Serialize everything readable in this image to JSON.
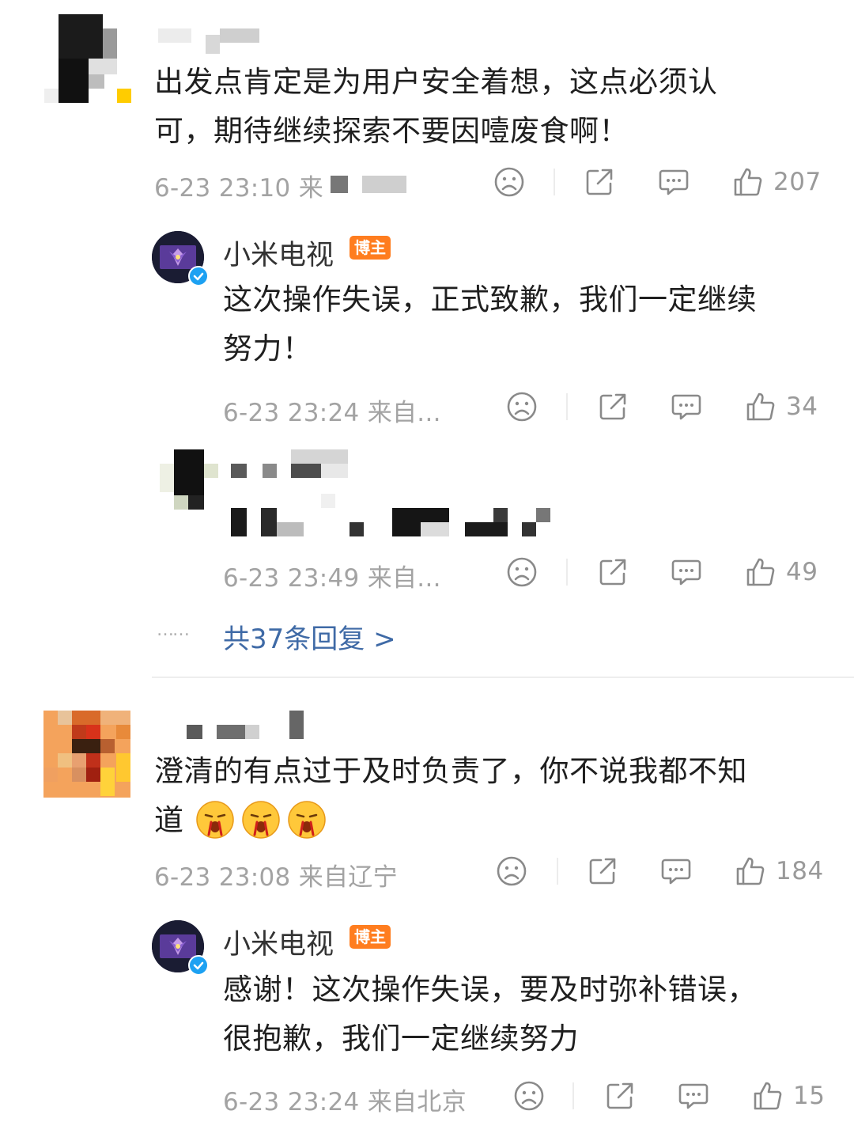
{
  "comments": [
    {
      "text": "出发点肯定是为用户安全着想，这点必须认可，期待继续探索不要因噎废食啊！",
      "line1": "出发点肯定是为用户安全着想，这点必须认",
      "line2": "可，期待继续探索不要因噎废食啊！",
      "meta": "6-23 23:10 来",
      "likes": "207",
      "replies": [
        {
          "author": "小米电视",
          "badge": "博主",
          "line1": "这次操作失误，正式致歉，我们一定继续",
          "line2": "努力！",
          "meta": "6-23 23:24 来自...",
          "likes": "34"
        },
        {
          "meta": "6-23 23:49 来自...",
          "likes": "49"
        }
      ],
      "more_dots": "……",
      "more_replies": "共37条回复 >"
    },
    {
      "line1": "澄清的有点过于及时负责了，你不说我都不知",
      "line2": "道",
      "meta": "6-23 23:08 来自辽宁",
      "likes": "184",
      "replies": [
        {
          "author": "小米电视",
          "badge": "博主",
          "line1": "感谢！这次操作失误，要及时弥补错误，",
          "line2": "很抱歉，我们一定继续努力",
          "meta": "6-23 23:24 来自北京",
          "likes": "15"
        }
      ]
    }
  ],
  "icons": [
    "sad-face-icon",
    "share-icon",
    "comment-icon",
    "thumbs-up-icon",
    "verified-icon"
  ],
  "colors": {
    "link": "#3f6aa6",
    "badge": "#ff7d1f",
    "meta": "#a3a3a3",
    "verified": "#1da1f2"
  }
}
